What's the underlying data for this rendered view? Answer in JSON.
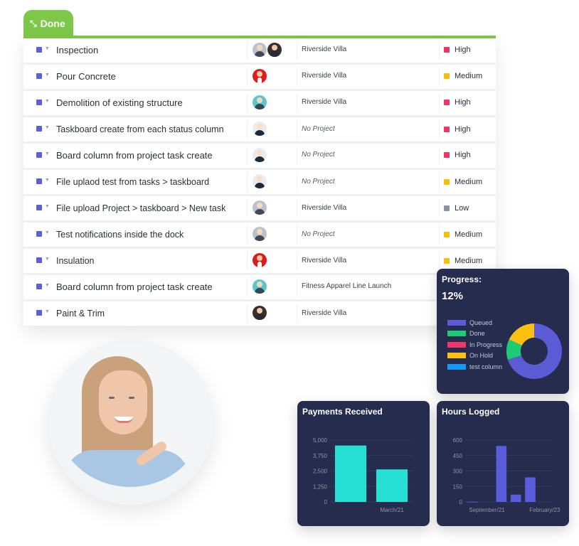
{
  "group": {
    "label": "Done",
    "icon": "collapse-arrows-icon",
    "color": "#7dc849"
  },
  "tasks": [
    {
      "name": "Inspection",
      "size": "big",
      "avatars": [
        "grey",
        "dark"
      ],
      "project": "Riverside Villa",
      "project_none": false,
      "priority": "High",
      "priority_color": "#f0365f"
    },
    {
      "name": "Pour Concrete",
      "size": "big",
      "avatars": [
        "red"
      ],
      "project": "Riverside Villa",
      "project_none": false,
      "priority": "Medium",
      "priority_color": "#fbbd08"
    },
    {
      "name": "Demolition of existing structure",
      "size": "big",
      "avatars": [
        "teal"
      ],
      "project": "Riverside Villa",
      "project_none": false,
      "priority": "High",
      "priority_color": "#f0365f"
    },
    {
      "name": "Taskboard create from each status column",
      "size": "normal",
      "avatars": [
        "white"
      ],
      "project": "No Project",
      "project_none": true,
      "priority": "High",
      "priority_color": "#f0365f"
    },
    {
      "name": "Board column from project task create",
      "size": "big",
      "avatars": [
        "white"
      ],
      "project": "No Project",
      "project_none": true,
      "priority": "High",
      "priority_color": "#f0365f"
    },
    {
      "name": "File uplaod test from tasks > taskboard",
      "size": "normal",
      "avatars": [
        "white"
      ],
      "project": "No Project",
      "project_none": true,
      "priority": "Medium",
      "priority_color": "#fbbd08"
    },
    {
      "name": "File upload Project > taskboard > New task",
      "size": "normal",
      "avatars": [
        "grey"
      ],
      "project": "Riverside Villa",
      "project_none": false,
      "priority": "Low",
      "priority_color": "#8a93a6"
    },
    {
      "name": "Test notifications inside the dock",
      "size": "normal",
      "avatars": [
        "grey"
      ],
      "project": "No Project",
      "project_none": true,
      "priority": "Medium",
      "priority_color": "#fbbd08"
    },
    {
      "name": "Insulation",
      "size": "normal",
      "avatars": [
        "red"
      ],
      "project": "Riverside Villa",
      "project_none": false,
      "priority": "Medium",
      "priority_color": "#fbbd08"
    },
    {
      "name": "Board column from project task create",
      "size": "big",
      "avatars": [
        "teal"
      ],
      "project": "Fitness Apparel Line Launch",
      "project_none": false,
      "priority": "",
      "priority_color": ""
    },
    {
      "name": "Paint & Trim",
      "size": "normal",
      "avatars": [
        "dark"
      ],
      "project": "Riverside Villa",
      "project_none": false,
      "priority": "",
      "priority_color": ""
    }
  ],
  "progress": {
    "title": "Progress:",
    "value": "12%"
  },
  "chart_data": [
    {
      "type": "pie",
      "title": "Progress:",
      "subtitle": "12%",
      "legend": "left",
      "categories": [
        "Queued",
        "Done",
        "In Progress",
        "On Hold",
        "test column"
      ],
      "values": [
        70,
        12,
        0,
        18,
        0
      ],
      "colors": [
        "#5b5bd6",
        "#1ecb75",
        "#f2386a",
        "#fcc010",
        "#1499f5"
      ]
    },
    {
      "type": "bar",
      "title": "Payments Received",
      "categories": [
        "",
        "March/21"
      ],
      "values": [
        4560,
        2630
      ],
      "ylim": [
        0,
        5000
      ],
      "yticks": [
        "0",
        "1,250",
        "2,500",
        "3,750",
        "5,000"
      ],
      "color": "#26e0d4",
      "xlabel": "",
      "ylabel": "",
      "grid": true
    },
    {
      "type": "bar",
      "title": "Hours Logged",
      "categories": [
        "",
        "September/21",
        "",
        "",
        "",
        "February/23"
      ],
      "values": [
        2,
        0,
        543,
        71,
        238,
        0
      ],
      "ylim": [
        0,
        600
      ],
      "yticks": [
        "0",
        "150",
        "300",
        "450",
        "600"
      ],
      "color": "#5a5ddb",
      "xlabel": "",
      "ylabel": "",
      "grid": true
    }
  ]
}
